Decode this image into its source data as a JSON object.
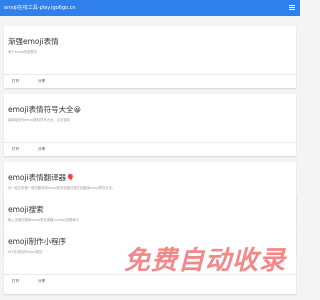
{
  "header": {
    "title": "emoji在线工具-play.igo6go.cn"
  },
  "cards": [
    {
      "title": "渐强emoji表情",
      "title_icon": "",
      "desc": "用于emoji改造表情",
      "open_label": "打开",
      "share_label": "分享"
    },
    {
      "title": "emoji表情符号大全",
      "title_icon": "😀",
      "desc": "最新最全的emoji表情符号大全，点击复制",
      "open_label": "打开",
      "share_label": "分享"
    },
    {
      "title": "emoji表情翻译器",
      "title_icon": "🎈",
      "desc": "对一段文本做一键式翻译成emoji表情或通过表情包翻译emoji表情文本。",
      "open_label": "打开",
      "share_label": "分享"
    },
    {
      "title": "emoji搜索",
      "title_icon": "",
      "desc": "输入关键词搜索emoji表情或输入emoji查看释义",
      "open_label": "打开",
      "share_label": "分享"
    },
    {
      "title": "emoji制作小程序",
      "title_icon": "",
      "desc": "DIY合成你的emoji表情",
      "open_label": "打开",
      "share_label": "分享"
    }
  ],
  "watermark": {
    "text": "免费自动收录"
  },
  "colors": {
    "header_bg": "#2f80ed",
    "watermark": "#ee4646"
  }
}
